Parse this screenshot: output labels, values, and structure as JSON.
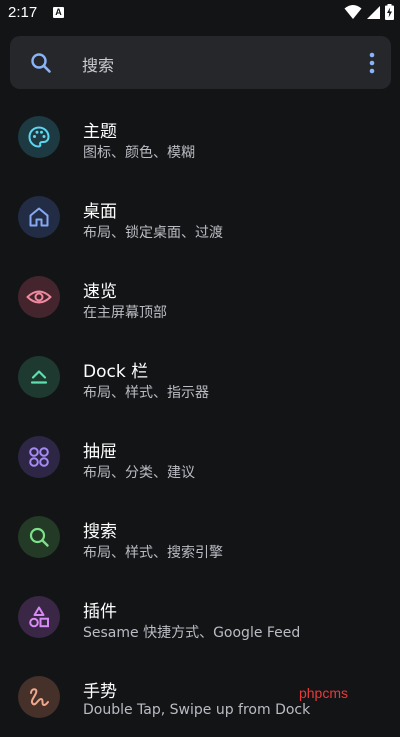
{
  "status_bar": {
    "time": "2:17",
    "notification_badge": "A"
  },
  "search": {
    "placeholder": "搜索"
  },
  "colors": {
    "background": "#131416",
    "search_bar": "#25272b",
    "accent_blue": "#8ab4f8"
  },
  "items": [
    {
      "title": "主题",
      "subtitle": "图标、颜色、模糊",
      "icon": "palette-icon",
      "icon_color": "#5ed6f0",
      "icon_bg": "#1d3a42"
    },
    {
      "title": "桌面",
      "subtitle": "布局、锁定桌面、过渡",
      "icon": "home-icon",
      "icon_color": "#86a8f5",
      "icon_bg": "#222c45"
    },
    {
      "title": "速览",
      "subtitle": "在主屏幕顶部",
      "icon": "eye-icon",
      "icon_color": "#f08aa0",
      "icon_bg": "#45252d"
    },
    {
      "title": "Dock 栏",
      "subtitle": "布局、样式、指示器",
      "icon": "dock-icon",
      "icon_color": "#5de0b0",
      "icon_bg": "#1e3a30"
    },
    {
      "title": "抽屉",
      "subtitle": "布局、分类、建议",
      "icon": "apps-grid-icon",
      "icon_color": "#a68af5",
      "icon_bg": "#2d2645"
    },
    {
      "title": "搜索",
      "subtitle": "布局、样式、搜索引擎",
      "icon": "search-icon",
      "icon_color": "#7fe08a",
      "icon_bg": "#223a26"
    },
    {
      "title": "插件",
      "subtitle": "Sesame 快捷方式、Google Feed",
      "icon": "shapes-icon",
      "icon_color": "#d88af5",
      "icon_bg": "#3a2645"
    },
    {
      "title": "手势",
      "subtitle": "Double Tap, Swipe up from Dock",
      "icon": "gesture-icon",
      "icon_color": "#f0a88a",
      "icon_bg": "#45302a"
    }
  ],
  "watermark": "phpcms"
}
